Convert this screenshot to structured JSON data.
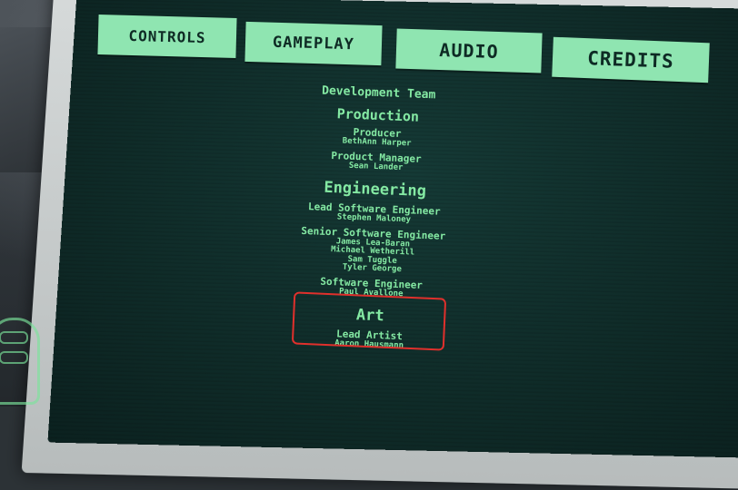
{
  "tabs": [
    {
      "label": "CONTROLS"
    },
    {
      "label": "GAMEPLAY"
    },
    {
      "label": "AUDIO"
    },
    {
      "label": "CREDITS"
    }
  ],
  "credits": {
    "team_heading": "Development Team",
    "production": {
      "heading": "Production",
      "producer_role": "Producer",
      "producer_name": "BethAnn Harper",
      "pm_role": "Product Manager",
      "pm_name": "Sean Lander"
    },
    "engineering": {
      "heading": "Engineering",
      "lead_role": "Lead Software Engineer",
      "lead_name": "Stephen Maloney",
      "senior_role": "Senior Software Engineer",
      "senior_names": [
        "James Lea-Baran",
        "Michael Wetherill",
        "Sam Tuggle",
        "Tyler George"
      ],
      "se_role": "Software Engineer",
      "se_name": "Paul Avallone"
    },
    "art": {
      "heading": "Art",
      "lead_role": "Lead Artist",
      "lead_name": "Aaron Hausmann"
    }
  },
  "colors": {
    "screen": "#0f2b28",
    "text": "#84e9a3",
    "tab": "#8fe5b1",
    "highlight": "#e0302c"
  },
  "icons": {
    "hand": "controller-hand-icon"
  }
}
